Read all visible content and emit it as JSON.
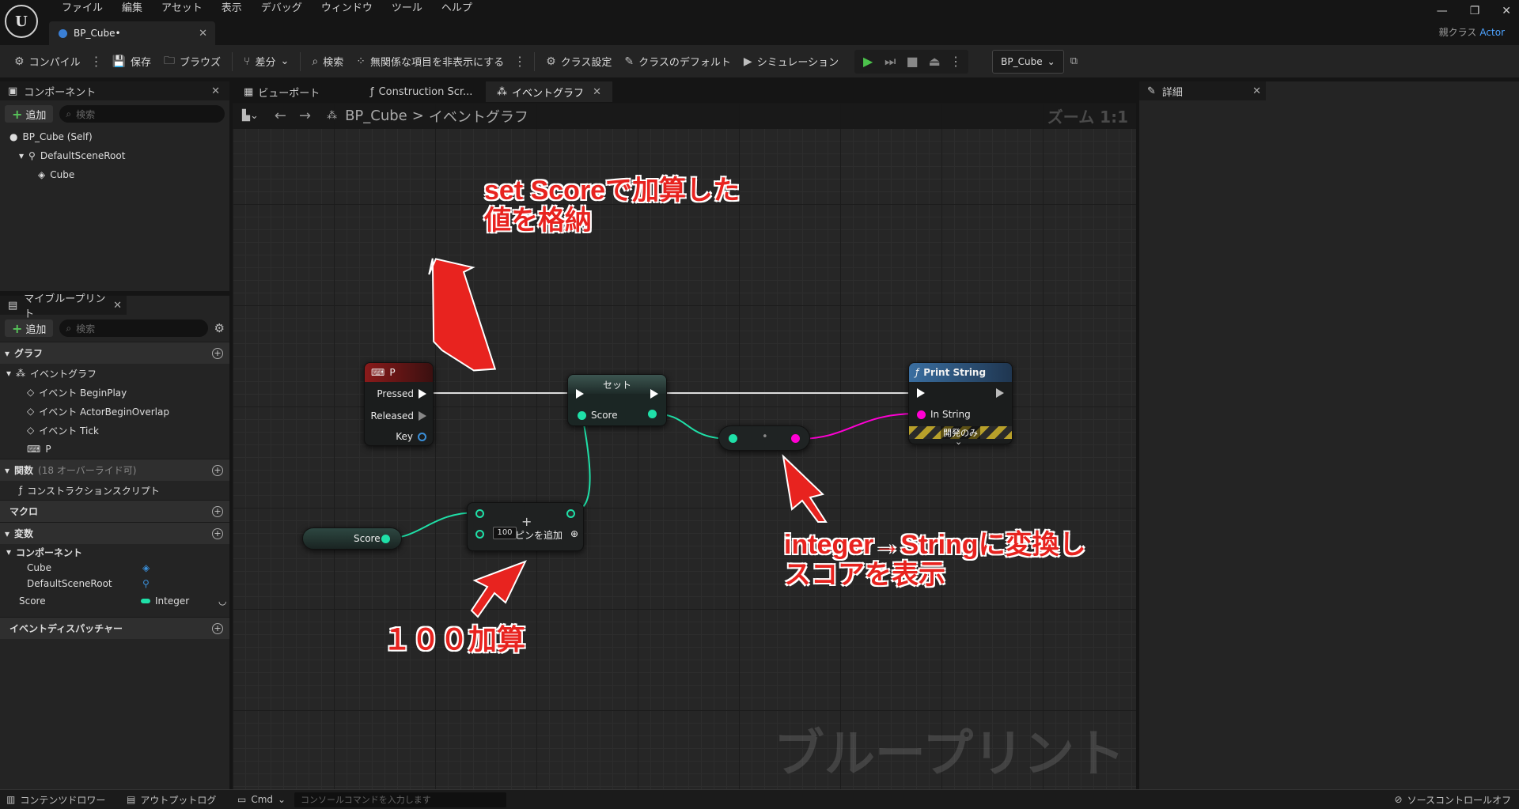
{
  "menu": [
    "ファイル",
    "編集",
    "アセット",
    "表示",
    "デバッグ",
    "ウィンドウ",
    "ツール",
    "ヘルプ"
  ],
  "doc_tab": {
    "label": "BP_Cube•"
  },
  "parent_class": {
    "label": "親クラス",
    "value": "Actor"
  },
  "toolbar": {
    "compile": "コンパイル",
    "save": "保存",
    "browse": "ブラウズ",
    "diff": "差分",
    "search": "検索",
    "hide_unrelated": "無関係な項目を非表示にする",
    "class_settings": "クラス設定",
    "class_defaults": "クラスのデフォルト",
    "simulation": "シミュレーション",
    "bp_selector": "BP_Cube"
  },
  "components_panel": {
    "tab": "コンポーネント",
    "add": "追加",
    "search_placeholder": "検索",
    "tree": [
      "BP_Cube (Self)",
      "DefaultSceneRoot",
      "Cube"
    ]
  },
  "my_blueprint": {
    "tab": "マイブループリント",
    "add": "追加",
    "search_placeholder": "検索",
    "graph_section": "グラフ",
    "event_graph": "イベントグラフ",
    "events": [
      "イベント BeginPlay",
      "イベント ActorBeginOverlap",
      "イベント Tick",
      "P"
    ],
    "functions_section": "関数",
    "functions_sub": "(18 オーバーライド可)",
    "construction_script": "コンストラクションスクリプト",
    "macros_section": "マクロ",
    "variables_section": "変数",
    "components_group": "コンポーネント",
    "var_cube": "Cube",
    "var_root": "DefaultSceneRoot",
    "var_score": "Score",
    "var_score_type": "Integer",
    "dispatchers_section": "イベントディスパッチャー"
  },
  "graph_tabs": [
    "ビューポート",
    "Construction Scr...",
    "イベントグラフ"
  ],
  "breadcrumb": {
    "bp": "BP_Cube",
    "sep": ">",
    "graph": "イベントグラフ"
  },
  "zoom": "ズーム 1:1",
  "watermark": "ブループリント",
  "details_tab": "詳細",
  "nodes": {
    "p_event": {
      "title": "P",
      "pressed": "Pressed",
      "released": "Released",
      "key": "Key"
    },
    "set": {
      "title": "セット",
      "score": "Score"
    },
    "print": {
      "title": "Print String",
      "in_string": "In String",
      "dev_only": "開発のみ"
    },
    "get_score": {
      "label": "Score"
    },
    "add": {
      "value": "100",
      "add_pin": "ピンを追加"
    }
  },
  "annotations": {
    "top": [
      "set Scoreで加算した",
      "値を格納"
    ],
    "right": [
      "integer→Stringに変換し",
      "スコアを表示"
    ],
    "bottom": "１００加算"
  },
  "bottom": {
    "content_drawer": "コンテンツドロワー",
    "output_log": "アウトプットログ",
    "cmd": "Cmd",
    "console_placeholder": "コンソールコマンドを入力します",
    "source_control": "ソースコントロールオフ"
  },
  "colors": {
    "exec": "#ffffff",
    "integer": "#1fe0a8",
    "string": "#ff00d4",
    "event_head": "#8a1a1a",
    "func_head": "#3a6ea0",
    "annotation": "#e8231f"
  }
}
